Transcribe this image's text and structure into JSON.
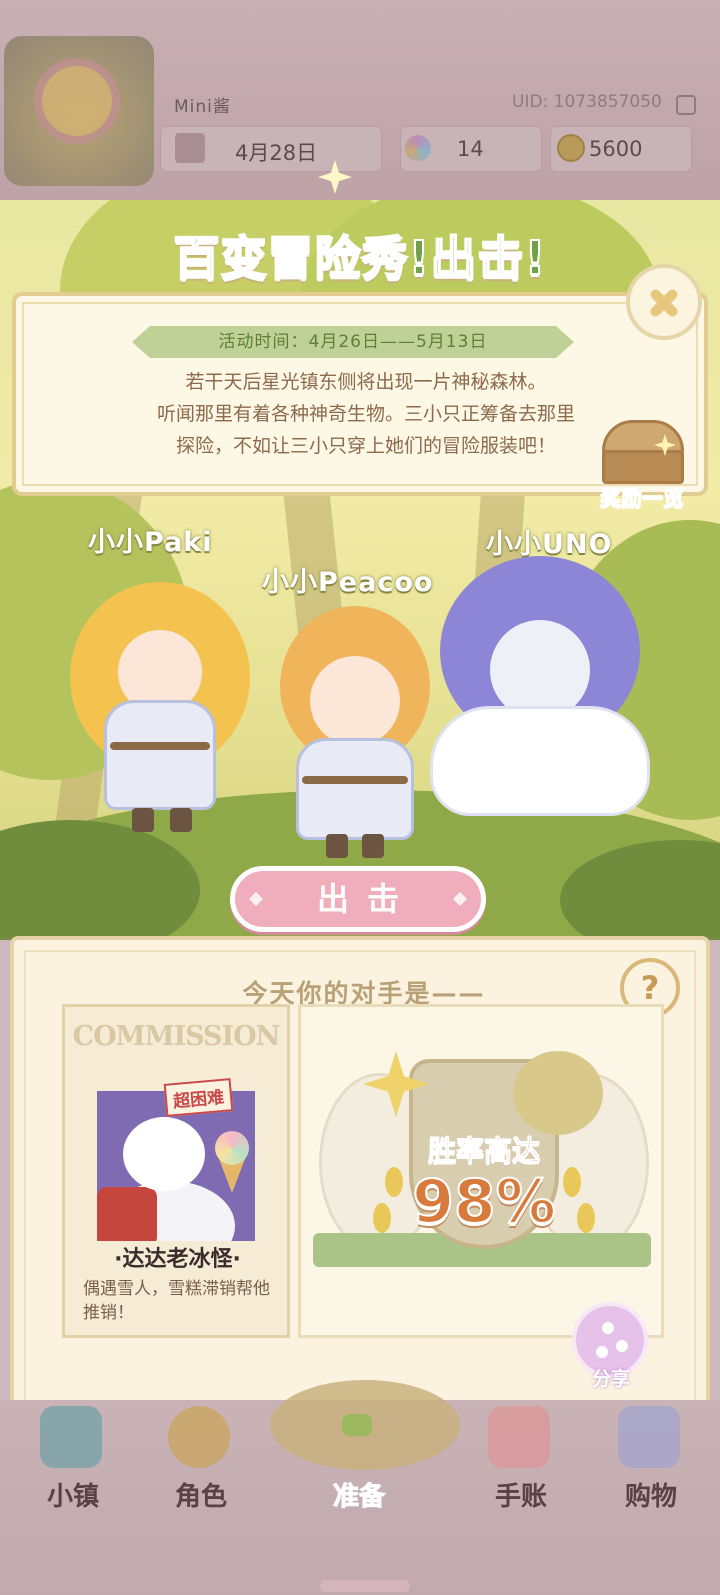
{
  "header": {
    "username": "Mini酱",
    "uid": "UID: 1073857050",
    "date": "4月28日",
    "gems": "14",
    "coins": "5600"
  },
  "event": {
    "title": "百变冒险秀!出击!",
    "period_label": "活动时间：4月26日——5月13日",
    "description_lines": [
      "若干天后星光镇东侧将出现一片神秘森林。",
      "听闻那里有着各种神奇生物。三小只正筹备去那里",
      "探险，不如让三小只穿上她们的冒险服装吧！"
    ],
    "reward_label": "奖励一览"
  },
  "characters": [
    {
      "name": "小小Paki"
    },
    {
      "name": "小小Peacoo"
    },
    {
      "name": "小小UNO"
    }
  ],
  "go_button": "出击",
  "opponent": {
    "section_title": "今天你的对手是——",
    "help": "?",
    "card_header": "COMMISSION",
    "difficulty_stamp": "超困难",
    "name": "·达达老冰怪·",
    "description": "偶遇雪人，雪糕滞销帮他推销！",
    "win_label": "胜率高达",
    "win_rate": "98%"
  },
  "share_label": "分享",
  "nav": {
    "items": [
      {
        "label": "小镇",
        "icon": "map-icon"
      },
      {
        "label": "角色",
        "icon": "character-icon"
      },
      {
        "label": "准备",
        "icon": "basket-icon",
        "active": true
      },
      {
        "label": "手账",
        "icon": "journal-icon"
      },
      {
        "label": "购物",
        "icon": "shopping-bag-icon"
      }
    ]
  },
  "colors": {
    "title_green": "#6fa04a",
    "go_button_pink": "#f0aebd",
    "win_rate_orange": "#d77a3c",
    "panel_cream": "#fbf3df"
  }
}
